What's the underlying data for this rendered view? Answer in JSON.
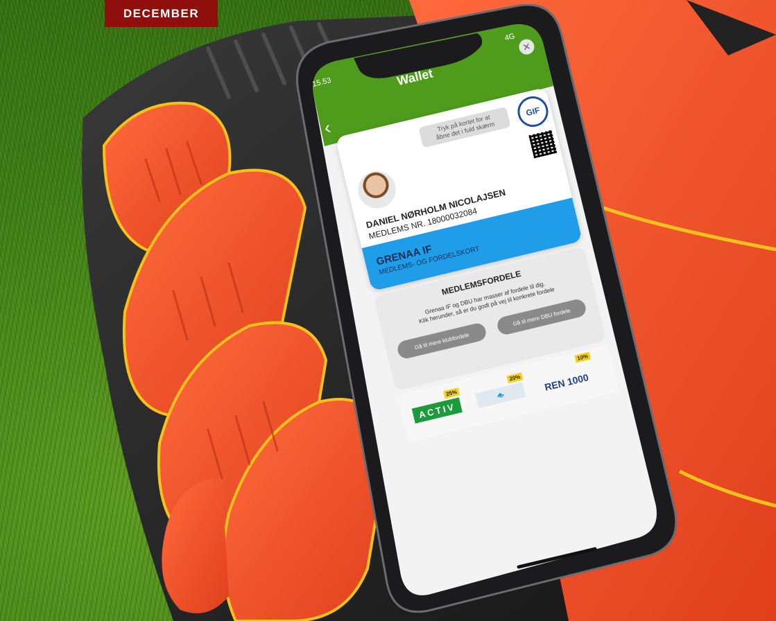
{
  "banner": {
    "label": "DECEMBER"
  },
  "status_bar": {
    "time": "15.53",
    "network": "4G"
  },
  "header": {
    "title": "Wallet"
  },
  "card": {
    "hint": "Tryk på kortet for at\nåbne det i fuld skærm",
    "logo_text": "GIF",
    "member_name": "DANIEL NØRHOLM NICOLAJSEN",
    "member_number": "MEDLEMS NR. 18000032084",
    "club_name": "GRENAA IF",
    "card_type": "MEDLEMS- OG FORDELSKORT"
  },
  "benefits": {
    "title": "MEDLEMSFORDELE",
    "description": "Grenaa IF og DBU har masser af fordele til dig.\nKlik herunder, så er du godt på vej til konkrete fordele",
    "button_club": "Gå til mere klubfordele",
    "button_dbu": "Gå til mere DBU fordele"
  },
  "partners": [
    {
      "name": "ACTIV",
      "badge": "25%"
    },
    {
      "name": "",
      "badge": "20%"
    },
    {
      "name": "REN 1000",
      "badge": "10%"
    }
  ],
  "colors": {
    "green": "#4f9c1c",
    "blue": "#1f9de8",
    "banner": "#8e0f0b",
    "glove_orange": "#f2582f"
  }
}
